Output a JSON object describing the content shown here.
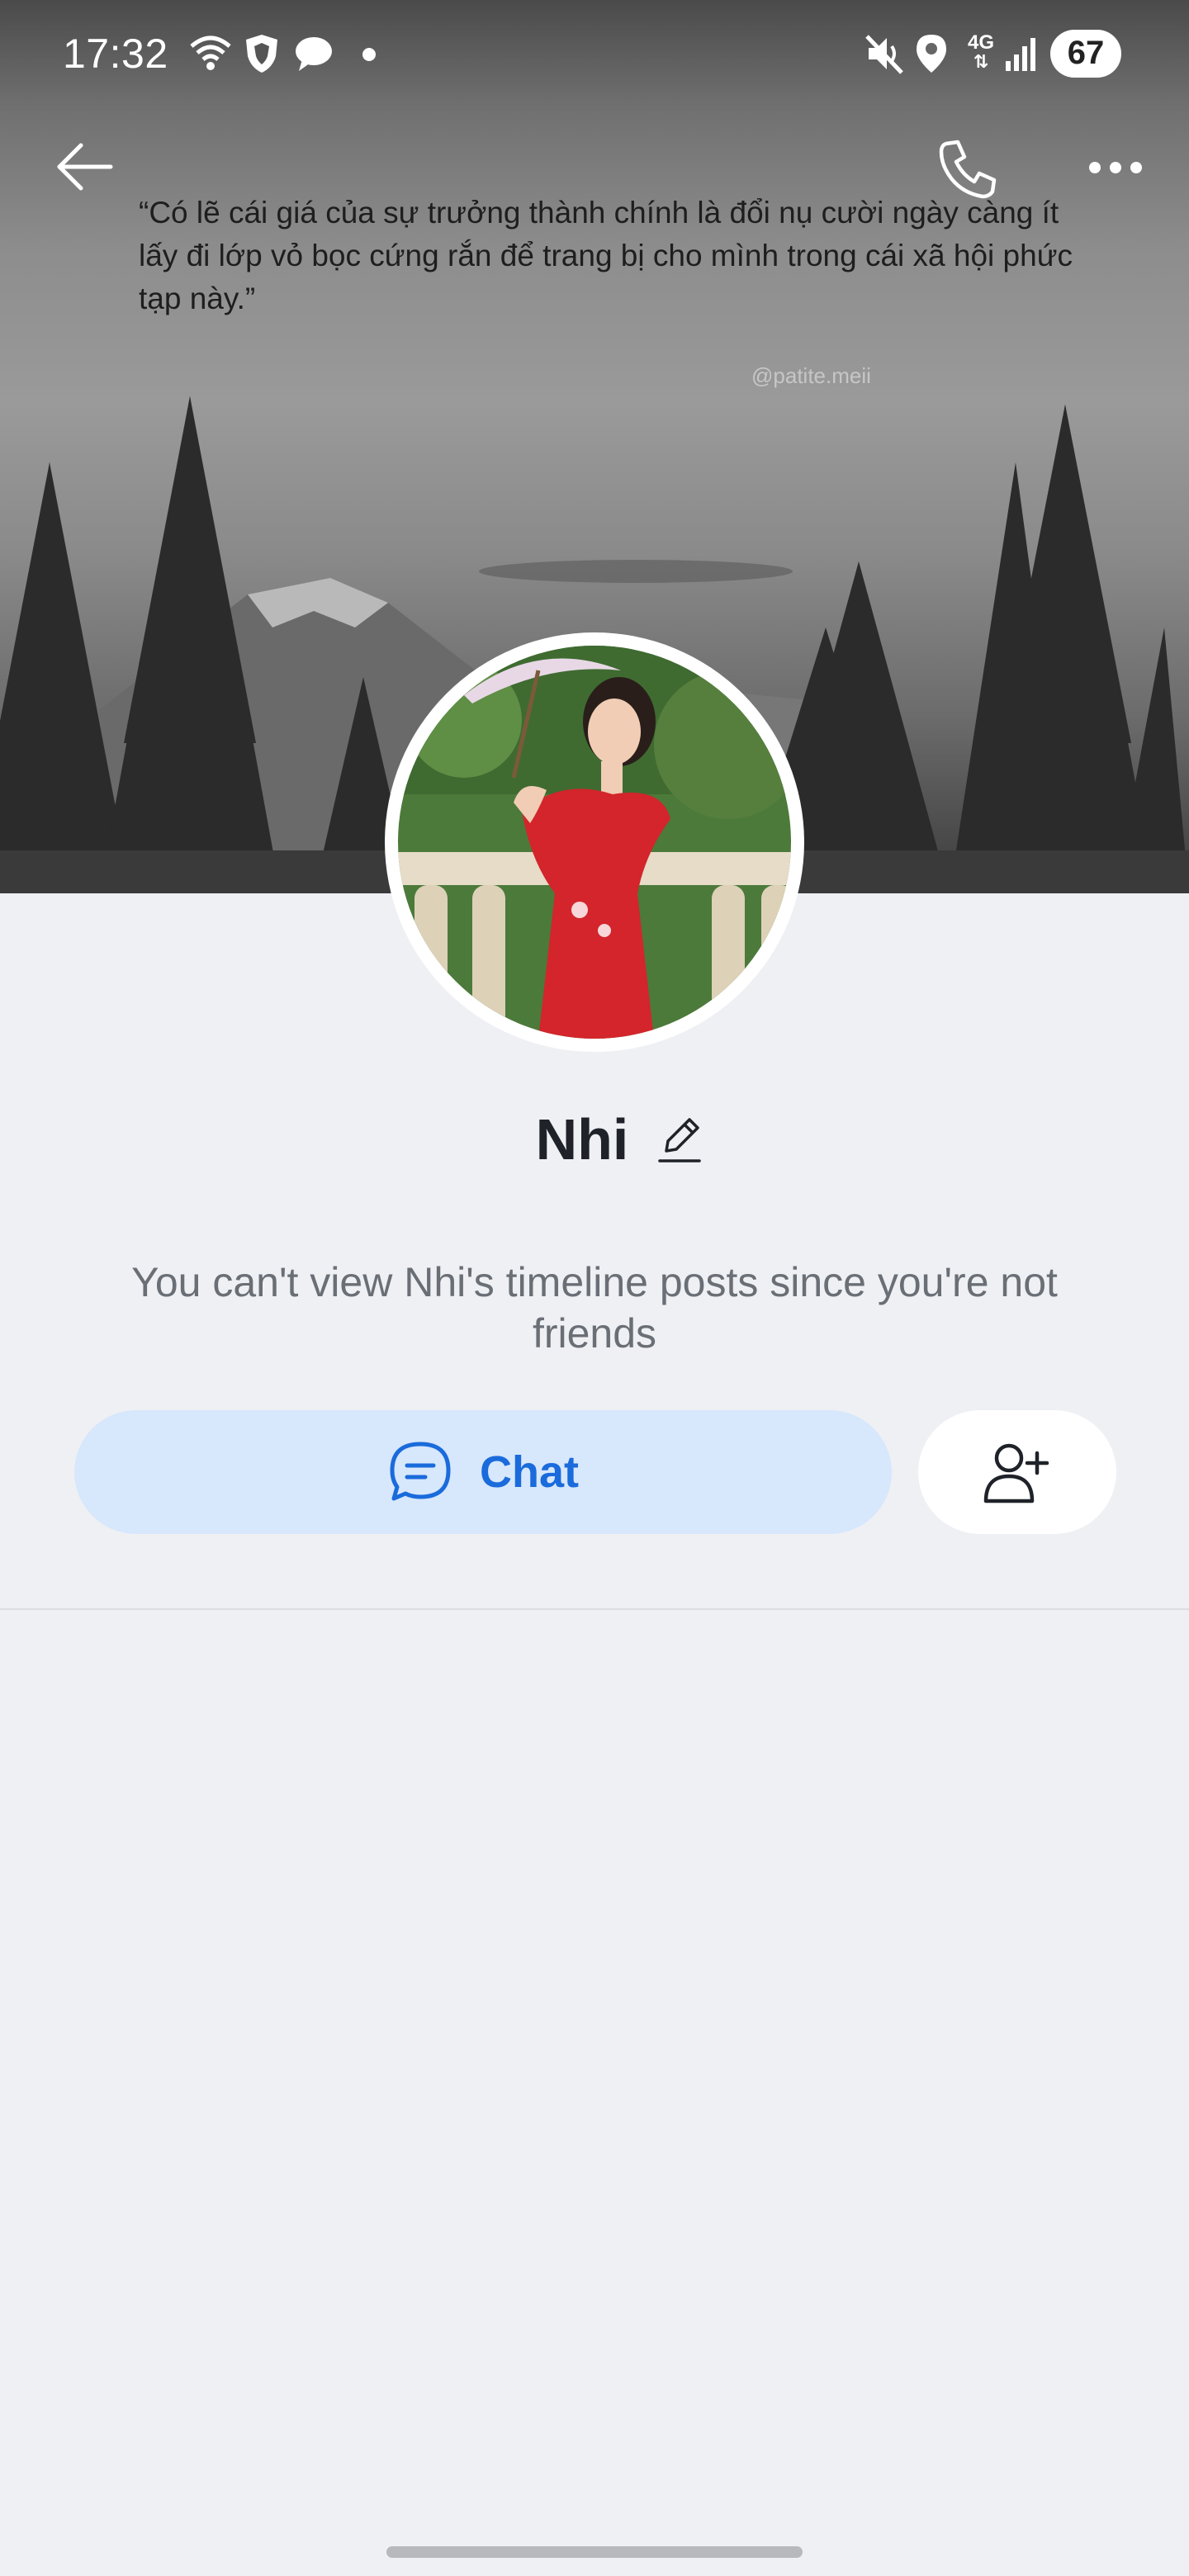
{
  "status_bar": {
    "time": "17:32",
    "network_label": "4G",
    "battery_level": "67",
    "icons": [
      "wifi-icon",
      "vpn-shield-icon",
      "chat-bubble-icon",
      "dot-icon",
      "mute-icon",
      "location-icon",
      "network-4g-icon",
      "signal-icon",
      "battery-icon"
    ]
  },
  "top_bar": {
    "icons": [
      "back-arrow-icon",
      "phone-call-icon",
      "more-options-icon"
    ]
  },
  "cover": {
    "quote": "“Có lẽ cái giá của sự trưởng thành chính là đổi nụ cười ngày càng ít lấy đi lớp vỏ bọc cứng rắn để trang bị cho mình trong cái xã hội phức tạp này.”",
    "watermark": "@patite.meii"
  },
  "profile": {
    "name": "Nhi",
    "notice": "You can't view Nhi's timeline posts since you're not friends"
  },
  "actions": {
    "chat_label": "Chat",
    "chat_icon": "chat-bubble-icon",
    "add_friend_icon": "add-friend-icon"
  },
  "colors": {
    "background": "#eff0f4",
    "chat_button_bg": "#d7e7fc",
    "accent_blue": "#1a6bdb",
    "notice_text": "#6a6f76"
  }
}
